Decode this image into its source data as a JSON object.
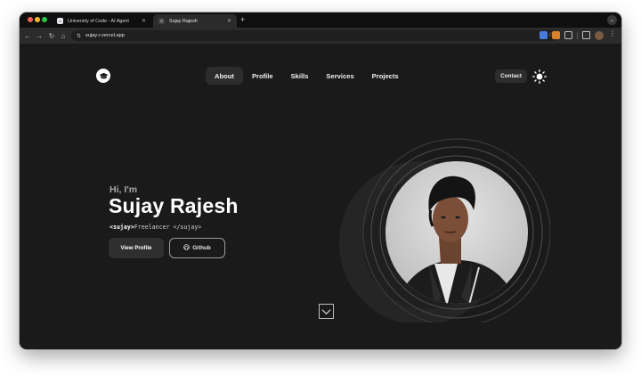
{
  "browser": {
    "tabs": [
      {
        "title": "University of Code - AI Agent",
        "favicon": "U",
        "active": false
      },
      {
        "title": "Sujay Rajesh",
        "favicon": "S",
        "active": true
      }
    ],
    "new_tab_label": "+",
    "url": "sujay-r.vercel.app"
  },
  "site": {
    "nav": [
      {
        "label": "About",
        "active": true
      },
      {
        "label": "Profile",
        "active": false
      },
      {
        "label": "Skills",
        "active": false
      },
      {
        "label": "Services",
        "active": false
      },
      {
        "label": "Projects",
        "active": false
      }
    ],
    "contact_label": "Contact"
  },
  "hero": {
    "greeting": "Hi, I'm",
    "name": "Sujay Rajesh",
    "tag_open": "<sujay>",
    "tag_text": "Freelancer ",
    "tag_close": "</sujay>",
    "primary_button": "View Profile",
    "secondary_button": "Github"
  },
  "icons": {
    "logo": "graduation-cap-icon",
    "theme": "sun-icon",
    "scroll": "chevron-down-icon",
    "github": "github-icon"
  },
  "colors": {
    "background": "#1a1a1a",
    "text": "#ffffff",
    "muted": "#a8a8a8",
    "button": "#2f2f2f"
  }
}
